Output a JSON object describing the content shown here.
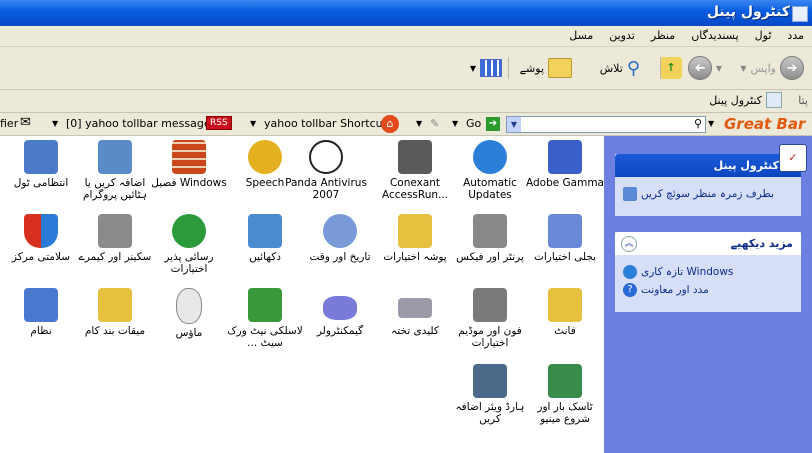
{
  "window": {
    "title": "کنٹرول پینل"
  },
  "menu": [
    "مسل",
    "تدوین",
    "منظر",
    "پسندیدگاں",
    "ٹول",
    "مدد"
  ],
  "toolbar": {
    "back": "واپس",
    "search": "تلاش",
    "folders": "پوشے"
  },
  "address": {
    "label": "پتا",
    "value": "کنٹرول پینل"
  },
  "linkbar": {
    "fier": "fier",
    "messages": "[0] yahoo tollbar messages",
    "rss": "RSS",
    "shortcuts": "yahoo tollbar Shortcuts",
    "go": "Go",
    "brand": "Great Bar"
  },
  "icons": [
    {
      "label": "Adobe Gamma",
      "color": "#3a5fc8"
    },
    {
      "label": "Automatic Updates",
      "color": "#2c7fd8"
    },
    {
      "label": "Conexant AccessRun...",
      "color": "#5a5a5a"
    },
    {
      "label": "Panda Antivirus 2007",
      "color": "#222222"
    },
    {
      "label": "Speech",
      "color": "#e4b020"
    },
    {
      "label": "Windows فصیل",
      "color": "#c8481c"
    },
    {
      "label": "اضافہ کریں یا ہٹائیں پروگرام",
      "color": "#5a8ac8"
    },
    {
      "label": "انتظامی ٹول",
      "color": "#4a7ac8"
    },
    {
      "label": "بجلی اختیارات",
      "color": "#6a8ad8"
    },
    {
      "label": "پرنٹر اور فیکس",
      "color": "#888888"
    },
    {
      "label": "پوشہ اختیارات",
      "color": "#e8c040"
    },
    {
      "label": "تاریخ اور وقت",
      "color": "#7a9ad8"
    },
    {
      "label": "دکھائیں",
      "color": "#4a8ad0"
    },
    {
      "label": "رسائی پذیر اختیارات",
      "color": "#2a9a3a"
    },
    {
      "label": "سکینر اور کیمرے",
      "color": "#8a8a8a"
    },
    {
      "label": "سلامتی مرکز",
      "color": "#d83020"
    },
    {
      "label": "فانٹ",
      "color": "#e8c040"
    },
    {
      "label": "فون اور موڈیم اختیارات",
      "color": "#7a7a7a"
    },
    {
      "label": "کلیدی تختہ",
      "color": "#9a9aa8"
    },
    {
      "label": "گیمکنٹرولر",
      "color": "#7a7ad8"
    },
    {
      "label": "لاسلکی نیٹ ورک سیٹ ...",
      "color": "#3a9a3a"
    },
    {
      "label": "ماؤس",
      "color": "#cccccc"
    },
    {
      "label": "میقات بند کام",
      "color": "#e8c040"
    },
    {
      "label": "نظام",
      "color": "#4a7ad0"
    },
    {
      "label": "ٹاسک بار اور شروع مینیو",
      "color": "#3a8a4a"
    },
    {
      "label": "ہارڈ ویئر اضافہ کریں",
      "color": "#4a6a8a"
    }
  ],
  "taskpane": {
    "panel1": {
      "title": "کنٹرول پینل",
      "link": "بطرف زمرہ منظر سوئچ کریں"
    },
    "panel2": {
      "title": "مزید دیکھیے",
      "links": [
        "Windows تازہ کاری",
        "مدد اور معاونت"
      ]
    }
  }
}
